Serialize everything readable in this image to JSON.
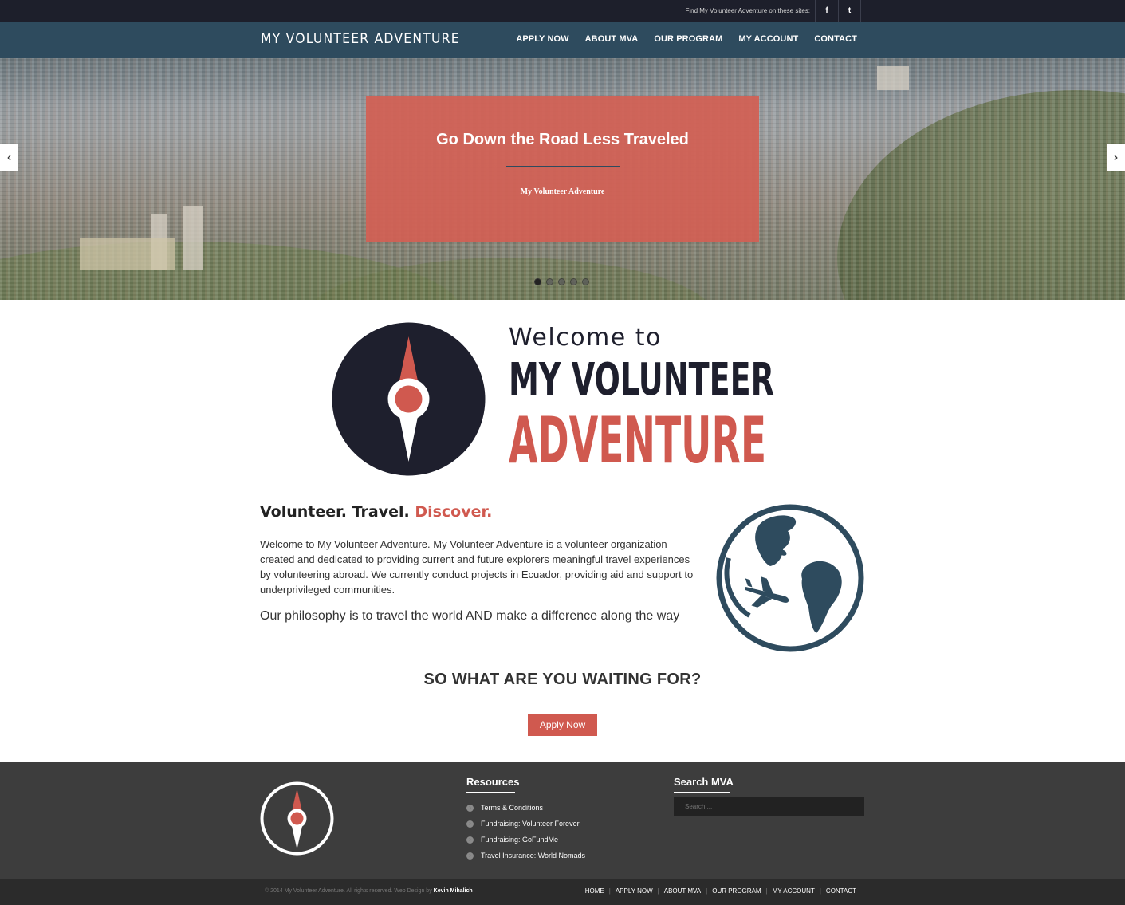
{
  "topbar": {
    "find_text": "Find My Volunteer Adventure on these sites:",
    "social": [
      {
        "label": "f",
        "icon": "facebook-icon"
      },
      {
        "label": "t",
        "icon": "twitter-icon"
      }
    ]
  },
  "nav": {
    "brand": "MY VOLUNTEER ADVENTURE",
    "items": [
      "APPLY NOW",
      "ABOUT MVA",
      "OUR PROGRAM",
      "MY ACCOUNT",
      "CONTACT"
    ]
  },
  "hero": {
    "title": "Go Down the Road Less Traveled",
    "subtitle": "My Volunteer Adventure",
    "prev_arrow": "‹",
    "next_arrow": "›",
    "slide_count": 5,
    "active_slide": 1
  },
  "welcome": {
    "line0": "Welcome to",
    "line1": "MY VOLUNTEER",
    "line2": "ADVENTURE"
  },
  "intro": {
    "tagline_plain": "Volunteer. Travel.",
    "tagline_accent": "Discover.",
    "paragraph": "Welcome to My Volunteer Adventure. My Volunteer Adventure is a volunteer organization created and dedicated to providing current and future explorers meaningful travel experiences by volunteering abroad. We currently conduct projects in Ecuador, providing aid and support to underprivileged communities.",
    "philosophy": "Our philosophy is to travel the world AND make a difference along the way",
    "cta_heading": "SO WHAT ARE YOU WAITING FOR?",
    "cta_button": "Apply Now"
  },
  "footer": {
    "resources_heading": "Resources",
    "resources": [
      "Terms & Conditions",
      "Fundraising: Volunteer Forever",
      "Fundraising: GoFundMe",
      "Travel Insurance: World Nomads"
    ],
    "search_heading": "Search MVA",
    "search_placeholder": "Search ...",
    "copyright": "© 2014 My Volunteer Adventure. All rights reserved. Web Design by",
    "designer": "Kevin Mihalich",
    "bottom_nav": [
      "HOME",
      "APPLY NOW",
      "ABOUT MVA",
      "OUR PROGRAM",
      "MY ACCOUNT",
      "CONTACT"
    ]
  },
  "colors": {
    "accent": "#d0594f",
    "navy": "#1e1f2d",
    "nav_bg": "#2e4b5e",
    "footer_bg": "#3d3d3d"
  }
}
